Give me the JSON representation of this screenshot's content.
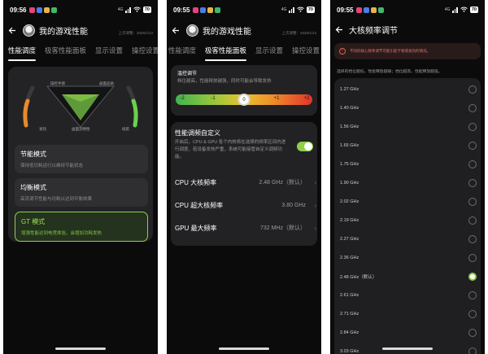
{
  "screen1": {
    "status": {
      "time": "09:56",
      "network": "4G",
      "battery": "70"
    },
    "title": "我的游戏性能",
    "updated": "上次调整：2026/1/14",
    "tabs": [
      "性能调度",
      "极客性能面板",
      "显示设置",
      "操控设置"
    ],
    "active_tab": 0,
    "gauge": {
      "top_left": "操控手感",
      "top_right": "画面品质",
      "bottom_left": "发热",
      "bottom_center": "画面流畅性",
      "bottom_right": "续航"
    },
    "modes": [
      {
        "title": "节能模式",
        "desc": "保持低功耗运行以维持节能状态"
      },
      {
        "title": "均衡模式",
        "desc": "高流调节性能与功耗以达到平衡效果"
      },
      {
        "title": "GT 模式",
        "desc": "增强性能达到电竞体验，会增加功耗发热"
      }
    ],
    "selected_mode": 2
  },
  "screen2": {
    "status": {
      "time": "09:55",
      "network": "4G",
      "battery": "70"
    },
    "title": "我的游戏性能",
    "updated": "上次调整：2026/1/14",
    "tabs": [
      "性能调度",
      "极客性能面板",
      "显示设置",
      "操控设置"
    ],
    "active_tab": 1,
    "temp": {
      "title": "温控调节",
      "desc": "档位越高，性能释放越强，同时可能会导致发热",
      "levels": [
        "-2",
        "-1",
        "0",
        "+1",
        "+2"
      ],
      "selected": "0"
    },
    "switch": {
      "title": "性能调频自定义",
      "desc": "开启后，CPU & GPU 各个内核将在选择的频率区间内进行调度，若设备发热严重，系统可能接管自定义调频功能。",
      "on": true
    },
    "rows": [
      {
        "label": "CPU 大核频率",
        "value": "2.48 GHz（默认）"
      },
      {
        "label": "CPU 超大核频率",
        "value": "3.80 GHz"
      },
      {
        "label": "GPU 最大频率",
        "value": "732 MHz（默认）"
      }
    ]
  },
  "screen3": {
    "status": {
      "time": "09:55",
      "network": "4G",
      "battery": "70"
    },
    "title": "大核频率调节",
    "warning": "不同的核心频率调节可能引起卡顿或发热的情况。",
    "note": "选择的档位越低，性能释放越弱；档位越高，性能释放越强。",
    "options": [
      "1.27 GHz",
      "1.40 GHz",
      "1.56 GHz",
      "1.65 GHz",
      "1.75 GHz",
      "1.90 GHz",
      "2.02 GHz",
      "2.19 GHz",
      "2.27 GHz",
      "2.36 GHz",
      "2.48 GHz（默认）",
      "2.61 GHz",
      "2.71 GHz",
      "2.84 GHz",
      "3.03 GHz"
    ],
    "selected": 10
  },
  "colors": {
    "accent": "#8fd04a",
    "background": "#0b0b0c",
    "card": "#222224",
    "warning": "#e85a4f"
  }
}
